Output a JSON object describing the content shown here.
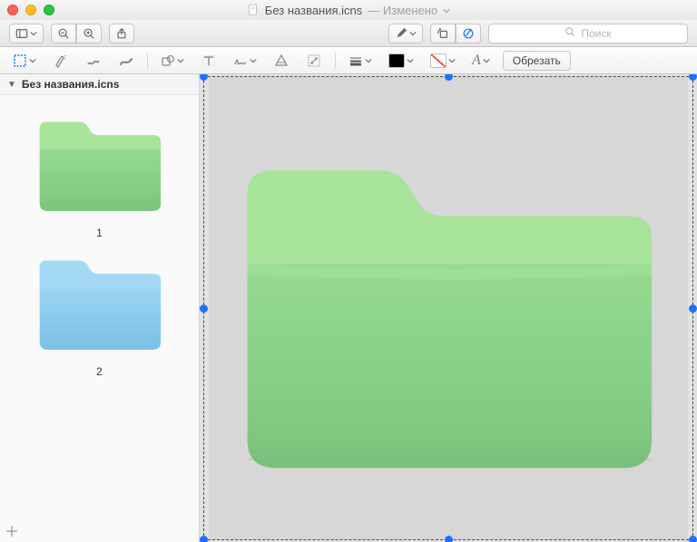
{
  "titlebar": {
    "filename": "Без названия.icns",
    "modified_suffix": "— Изменено"
  },
  "toolbar": {
    "search_placeholder": "Поиск"
  },
  "edit_toolbar": {
    "crop_label": "Обрезать"
  },
  "sidebar": {
    "header": "Без названия.icns",
    "thumbs": [
      {
        "label": "1",
        "color": "green"
      },
      {
        "label": "2",
        "color": "blue"
      }
    ]
  },
  "canvas": {
    "selected_color": "green"
  },
  "colors": {
    "green_tab": "#a7e49a",
    "green_body": "#8ed48a",
    "green_dark": "#7cc47d",
    "blue_tab": "#a4d9f5",
    "blue_body": "#8fcff0",
    "blue_dark": "#7bc0e6"
  }
}
